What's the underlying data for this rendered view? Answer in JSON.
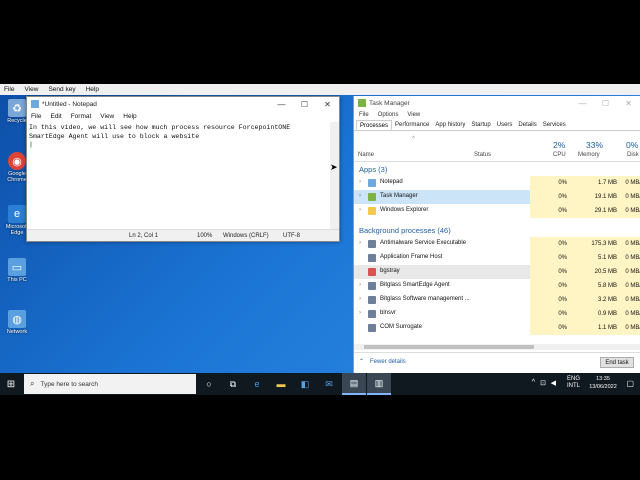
{
  "vm_menu": [
    "File",
    "View",
    "Send key",
    "Help"
  ],
  "desktop_icons": [
    {
      "name": "recycle-bin",
      "label": "Recycle",
      "color": "#7aa6d8",
      "glyph": "♻"
    },
    {
      "name": "google-chrome",
      "label": "Google Chrome",
      "color": "#db4437",
      "glyph": "◉"
    },
    {
      "name": "microsoft-edge",
      "label": "Microsoft Edge",
      "color": "#2a7fd5",
      "glyph": "e"
    },
    {
      "name": "this-pc",
      "label": "This PC",
      "color": "#5aa0e0",
      "glyph": "▭"
    },
    {
      "name": "network",
      "label": "Network",
      "color": "#5aa0e0",
      "glyph": "◍"
    }
  ],
  "notepad": {
    "title": "*Untitled - Notepad",
    "menu": [
      "File",
      "Edit",
      "Format",
      "View",
      "Help"
    ],
    "text": "In this video, we will see how much process resource ForcepointONE\nSmartEdge Agent will use to block a website\n|",
    "status": {
      "position": "Ln 2, Col 1",
      "zoom": "100%",
      "eol": "Windows (CRLF)",
      "encoding": "UTF-8"
    }
  },
  "taskmgr": {
    "title": "Task Manager",
    "menu": [
      "File",
      "Options",
      "View"
    ],
    "tabs": [
      "Processes",
      "Performance",
      "App history",
      "Startup",
      "Users",
      "Details",
      "Services"
    ],
    "columns": {
      "name": "Name",
      "status": "Status",
      "cpu_pct": "2%",
      "cpu": "CPU",
      "mem_pct": "33%",
      "mem": "Memory",
      "disk_pct": "0%",
      "disk": "Disk"
    },
    "apps_group": "Apps (3)",
    "apps": [
      {
        "name": "Notepad",
        "cpu": "0%",
        "mem": "1.7 MB",
        "disk": "0 MB/",
        "color": "#6fa8dc"
      },
      {
        "name": "Task Manager",
        "cpu": "0%",
        "mem": "19.1 MB",
        "disk": "0 MB/",
        "color": "#7cb342"
      },
      {
        "name": "Windows Explorer",
        "cpu": "0%",
        "mem": "29.1 MB",
        "disk": "0 MB/",
        "color": "#f2c94c"
      }
    ],
    "bg_group": "Background processes (46)",
    "background": [
      {
        "name": "Antimalware Service Executable",
        "cpu": "0%",
        "mem": "175.3 MB",
        "disk": "0 MB/",
        "color": "#6d7f99"
      },
      {
        "name": "Application Frame Host",
        "cpu": "0%",
        "mem": "5.1 MB",
        "disk": "0 MB/",
        "color": "#6d7f99"
      },
      {
        "name": "bgstray",
        "cpu": "0%",
        "mem": "20.5 MB",
        "disk": "0 MB/",
        "color": "#d9534f"
      },
      {
        "name": "Bitglass SmartEdge Agent",
        "cpu": "0%",
        "mem": "5.8 MB",
        "disk": "0 MB/",
        "color": "#6d7f99"
      },
      {
        "name": "Bitglass Software management ...",
        "cpu": "0%",
        "mem": "3.2 MB",
        "disk": "0 MB/",
        "color": "#6d7f99"
      },
      {
        "name": "blnsvr",
        "cpu": "0%",
        "mem": "0.9 MB",
        "disk": "0 MB/",
        "color": "#6d7f99"
      },
      {
        "name": "COM Surrogate",
        "cpu": "0%",
        "mem": "1.1 MB",
        "disk": "0 MB/",
        "color": "#6d7f99"
      }
    ],
    "fewer_details": "Fewer details",
    "end_task": "End task"
  },
  "taskbar": {
    "search_placeholder": "Type here to search",
    "tray_lang": "ENG",
    "tray_region": "INTL",
    "time": "13:35",
    "date": "13/06/2022"
  }
}
